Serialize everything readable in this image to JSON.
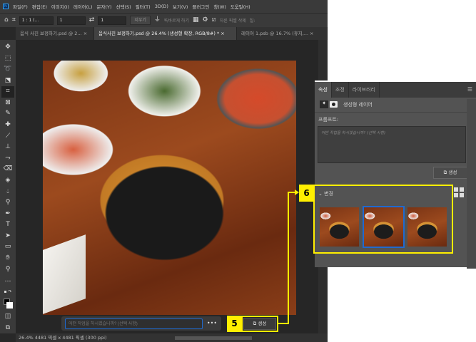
{
  "app": {
    "logo": "Ps"
  },
  "menu": [
    "파일(F)",
    "편집(E)",
    "이미지(I)",
    "레이어(L)",
    "문자(Y)",
    "선택(S)",
    "필터(T)",
    "3D(D)",
    "보기(V)",
    "플러그인",
    "창(W)",
    "도움말(H)"
  ],
  "options": {
    "ratio": "1 : 1 (...",
    "width": "1",
    "height": "1",
    "clear": "지우기",
    "straighten": "똑바르게 하기",
    "delete_cropped": "자른 픽셀 삭제",
    "fill_label": "칠:"
  },
  "tabs": [
    {
      "label": "음식 사진 보정하기.psd @ 2...",
      "active": false
    },
    {
      "label": "음식사진 보정하기.psd @ 26.4% (생성형 확장, RGB/8#) *",
      "active": true
    },
    {
      "label": "레이어 1.psb @ 16.7% (휴지,...",
      "active": false
    }
  ],
  "tools": [
    "move",
    "marquee",
    "lasso",
    "object-select",
    "crop",
    "frame",
    "eyedropper",
    "healing",
    "brush",
    "stamp",
    "history-brush",
    "eraser",
    "paint-bucket",
    "blur",
    "dodge",
    "pen",
    "type",
    "path-select",
    "rectangle",
    "hand",
    "zoom",
    "more"
  ],
  "contextual_bar": {
    "placeholder": "어떤 작업을 하시겠습니까? (선택 사항)",
    "generate": "생성"
  },
  "status": {
    "text": "26.4%  4481 픽셀 x 4481 픽셀 (300 ppi)"
  },
  "panel": {
    "tabs": [
      {
        "label": "속성",
        "active": true
      },
      {
        "label": "조정",
        "active": false
      },
      {
        "label": "라이브러리",
        "active": false
      }
    ],
    "layer_type": "생성형 레이어",
    "prompt_label": "프롬프트:",
    "prompt_placeholder": "어떤 작업을 하시겠습니까? (선택 사항)",
    "generate": "생성",
    "variations_label": "변경",
    "selected_variation": 2,
    "variation_count": 3
  },
  "annotations": {
    "five": "5",
    "six": "6",
    "color": "#ffef00"
  },
  "colors": {
    "accent": "#1f6ad0"
  }
}
